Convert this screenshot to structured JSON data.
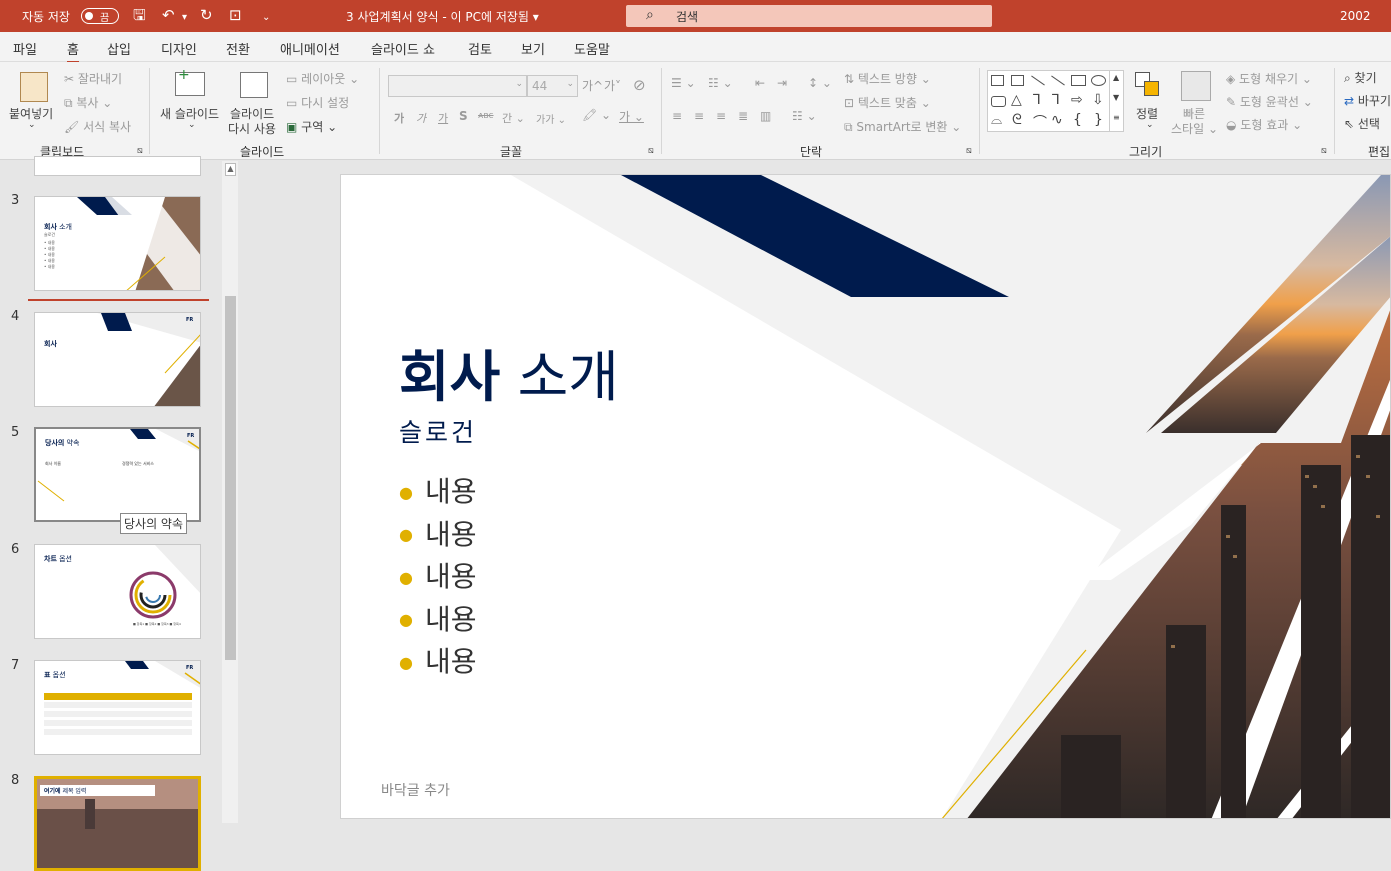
{
  "titlebar": {
    "autosave_label": "자동 저장",
    "autosave_state": "끔",
    "document_title": "3 사업계획서 양식 - 이 PC에 저장됨",
    "title_caret": "▾",
    "search_placeholder": "검색",
    "user": "2002"
  },
  "menu_tabs": [
    "파일",
    "홈",
    "삽입",
    "디자인",
    "전환",
    "애니메이션",
    "슬라이드 쇼",
    "검토",
    "보기",
    "도움말"
  ],
  "ribbon": {
    "clipboard": {
      "paste": "붙여넣기",
      "cut": "잘라내기",
      "copy": "복사",
      "format_painter": "서식 복사",
      "group": "클립보드"
    },
    "slides": {
      "new_slide": "새 슬라이드",
      "reuse_1": "슬라이드",
      "reuse_2": "다시 사용",
      "layout": "레이아웃",
      "reset": "다시 설정",
      "section": "구역",
      "group": "슬라이드"
    },
    "font": {
      "size": "44",
      "increase": "가^",
      "decrease": "가˅",
      "bold": "가",
      "italic": "가",
      "underline": "가",
      "shadow": "S",
      "strike": "ᴀʙᴄ",
      "spacing": "간",
      "case": "가가",
      "group": "글꼴"
    },
    "paragraph": {
      "text_direction": "텍스트 방향",
      "align_text": "텍스트 맞춤",
      "smartart": "SmartArt로 변환",
      "group": "단락"
    },
    "drawing": {
      "arrange": "정렬",
      "quick_styles_1": "빠른",
      "quick_styles_2": "스타일",
      "fill": "도형 채우기",
      "outline": "도형 윤곽선",
      "effects": "도형 효과",
      "group": "그리기"
    },
    "editing": {
      "find": "찾기",
      "replace": "바꾸기",
      "select": "선택",
      "group": "편집"
    }
  },
  "thumbnails": [
    {
      "num": "3",
      "title_bold": "회사",
      "title_rest": " 소개",
      "sub": "슬로건",
      "items": [
        "• 내용",
        "• 내용",
        "• 내용",
        "• 내용",
        "• 내용"
      ]
    },
    {
      "num": "4",
      "title_bold": "회사",
      "badge": "FR"
    },
    {
      "num": "5",
      "title_bold": "당사의",
      "title_rest": " 약속",
      "col1": "회사 이름",
      "col2": "경쟁력 있는 서비스",
      "badge": "FR"
    },
    {
      "num": "6",
      "title_bold": "차트",
      "title_rest": " 옵션",
      "legend": "■ 항목1  ■ 항목2  ■ 항목3  ■ 항목4"
    },
    {
      "num": "7",
      "title_bold": "표",
      "title_rest": " 옵션",
      "badge": "FR"
    },
    {
      "num": "8",
      "title_bold": "여기에",
      "title_rest": " 제목 입력"
    }
  ],
  "tooltip": "당사의 약속",
  "slide": {
    "title_bold": "회사",
    "title_rest": " 소개",
    "subtitle": "슬로건",
    "bullets": [
      "내용",
      "내용",
      "내용",
      "내용",
      "내용"
    ],
    "footer": "바닥글 추가"
  },
  "colors": {
    "accent": "#c0422c",
    "navy": "#001b4d",
    "gold": "#e0b000"
  }
}
